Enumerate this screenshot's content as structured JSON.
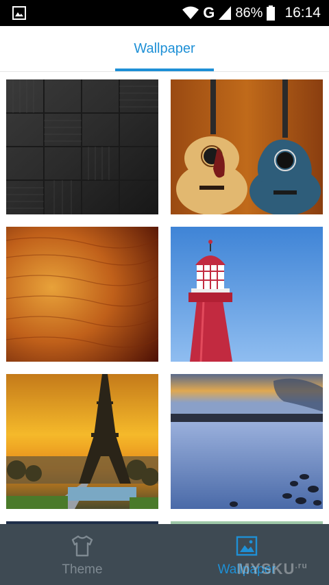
{
  "status_bar": {
    "network": "G",
    "battery": "86%",
    "time": "16:14",
    "icons": [
      "image-notification-icon",
      "wifi-icon",
      "signal-icon",
      "battery-icon"
    ]
  },
  "header": {
    "tab_label": "Wallpaper",
    "accent_color": "#1e90d6"
  },
  "wallpapers": [
    {
      "name": "dark-wood-parquet"
    },
    {
      "name": "acoustic-guitars"
    },
    {
      "name": "amber-wood-grain"
    },
    {
      "name": "red-lighthouse"
    },
    {
      "name": "eiffel-tower-sunset"
    },
    {
      "name": "blue-lake-shore"
    }
  ],
  "bottom_nav": {
    "items": [
      {
        "label": "Theme",
        "icon": "tshirt-icon",
        "active": false
      },
      {
        "label": "Wallpaper",
        "icon": "image-icon",
        "active": true
      }
    ],
    "inactive_color": "#7f8a92",
    "active_color": "#1e90d6"
  },
  "watermark": {
    "text": "MYSKU",
    "suffix": ".ru"
  }
}
